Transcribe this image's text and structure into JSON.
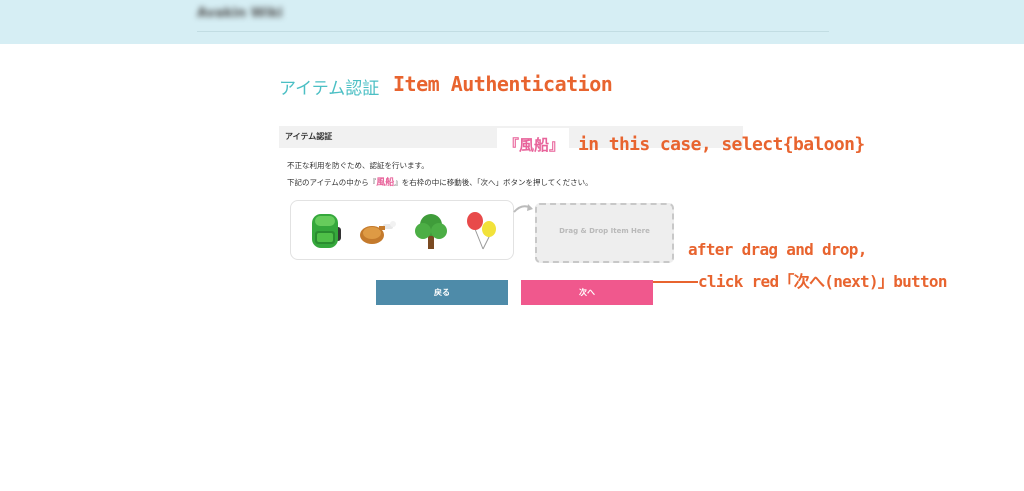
{
  "header": {
    "site_name": "Avakin Wiki"
  },
  "page": {
    "title": "アイテム認証",
    "title_annotation": "Item Authentication"
  },
  "section": {
    "header": "アイテム認証",
    "instruction1": "不正な利用を防ぐため、認証を行います。",
    "instruction2_prefix": "下記のアイテムの中から『",
    "instruction2_highlight": "風船",
    "instruction2_suffix": "』を右枠の中に移動後、「次へ」ボタンを押してください。"
  },
  "annotations": {
    "target_label": "『風船』",
    "case_text": "in this case, select{baloon}",
    "drag_line1": "after drag and drop,",
    "drag_line2": "click red「次へ(next)」button",
    "color": "#e8642f"
  },
  "items": [
    {
      "name": "backpack-icon"
    },
    {
      "name": "meat-icon"
    },
    {
      "name": "tree-icon"
    },
    {
      "name": "balloon-icon"
    }
  ],
  "drop_zone": {
    "label": "Drag & Drop Item Here"
  },
  "buttons": {
    "back_label": "戻る",
    "next_label": "次へ",
    "back_color": "#4e8ba9",
    "next_color": "#f0588d"
  }
}
